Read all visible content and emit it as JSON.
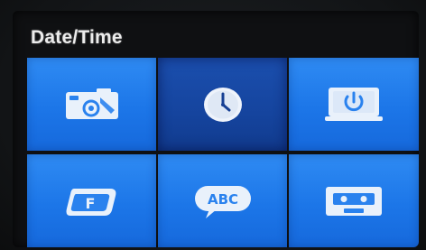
{
  "header": {
    "title": "Date/Time"
  },
  "menu": {
    "selected_index": 1,
    "tiles": [
      {
        "icon": "camera-icon"
      },
      {
        "icon": "clock-icon"
      },
      {
        "icon": "monitor-power-icon"
      },
      {
        "icon": "folder-f-icon"
      },
      {
        "icon": "abc-speech-bubble-icon",
        "text": "ABC"
      },
      {
        "icon": "cassette-tape-icon"
      }
    ]
  },
  "colors": {
    "tile": "#1f7bee",
    "tile_selected": "#15449e",
    "icon_fill": "#e9f1fb"
  }
}
